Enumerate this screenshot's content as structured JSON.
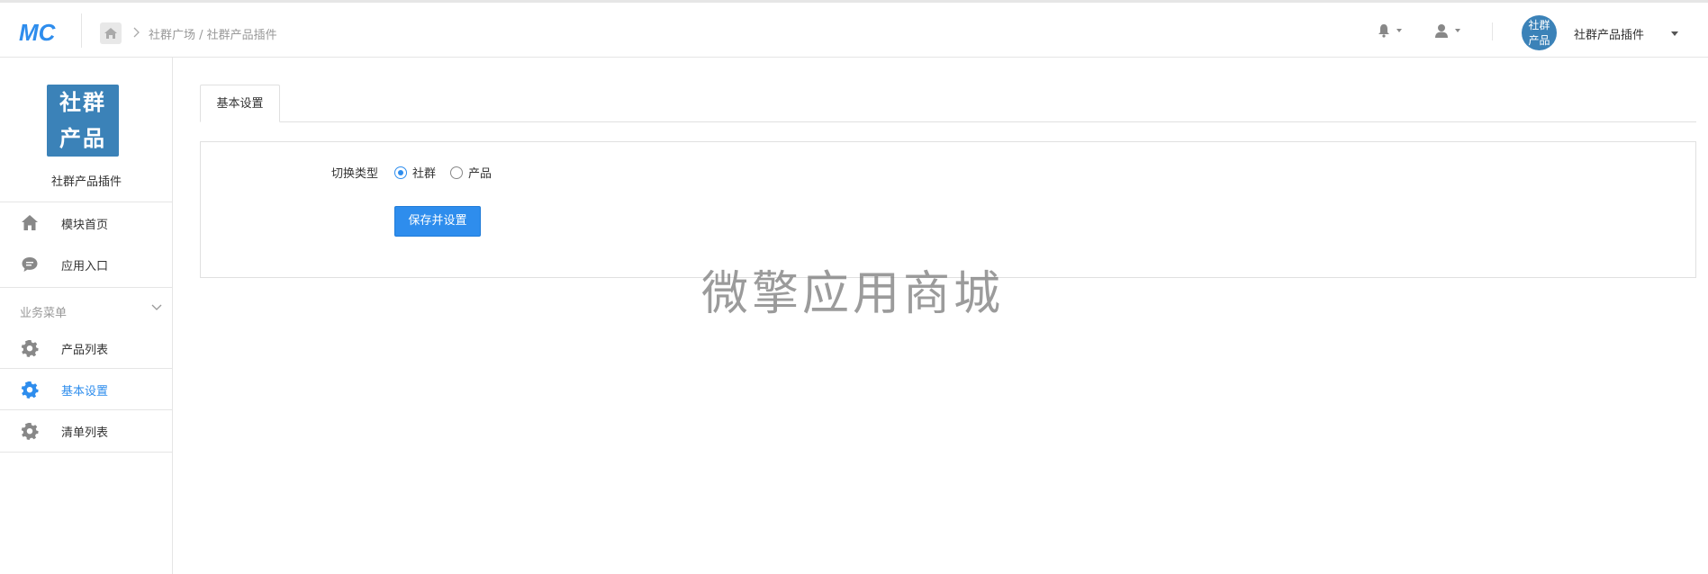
{
  "header": {
    "logo_text": "MC",
    "breadcrumb": "社群广场 / 社群产品插件",
    "avatar_text_line1": "社群",
    "avatar_text_line2": "产品",
    "account_name": "社群产品插件"
  },
  "sidebar": {
    "module_logo_line1": "社群",
    "module_logo_line2": "产品",
    "module_name": "社群产品插件",
    "top_items": [
      {
        "label": "模块首页",
        "icon": "home-icon"
      },
      {
        "label": "应用入口",
        "icon": "chat-icon"
      }
    ],
    "group_title": "业务菜单",
    "group_items": [
      {
        "label": "产品列表",
        "icon": "gear-icon"
      },
      {
        "label": "基本设置",
        "icon": "gear-icon",
        "active": true
      },
      {
        "label": "清单列表",
        "icon": "gear-icon"
      }
    ]
  },
  "main": {
    "tab_label": "基本设置",
    "field_label": "切换类型",
    "options": [
      {
        "label": "社群",
        "selected": true
      },
      {
        "label": "产品",
        "selected": false
      }
    ],
    "save_label": "保存并设置"
  },
  "watermark": "微擎应用商城",
  "colors": {
    "accent": "#2e8ded",
    "brand": "#3b82b8"
  }
}
